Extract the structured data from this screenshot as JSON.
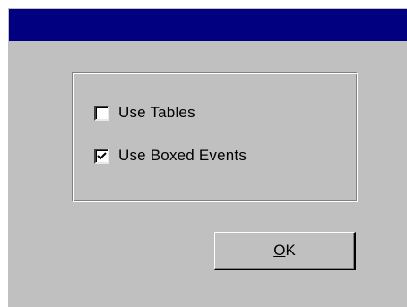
{
  "window": {
    "title": ""
  },
  "options": [
    {
      "label": "Use Tables",
      "checked": false
    },
    {
      "label": "Use Boxed Events",
      "checked": true
    }
  ],
  "ok_button": {
    "mnemonic": "O",
    "rest": "K"
  },
  "colors": {
    "titlebar": "#000080",
    "face": "#c0c0c0"
  },
  "icons": {
    "checkmark": "checkmark-icon"
  }
}
